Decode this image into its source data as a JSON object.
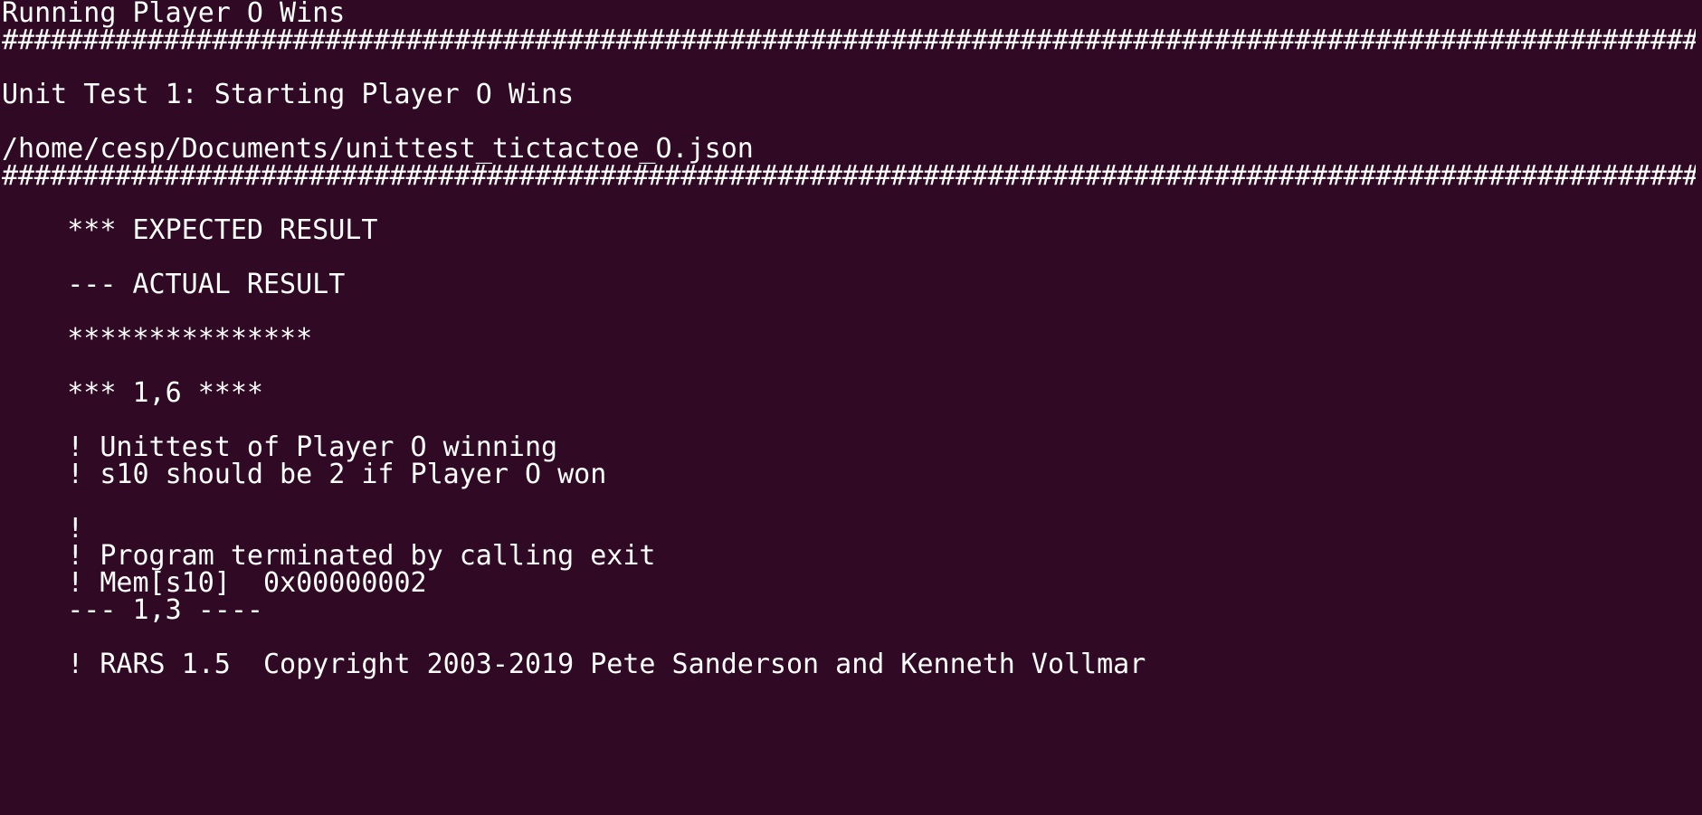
{
  "terminal": {
    "lines": [
      "Running Player O Wins",
      "##############################################################################################################################",
      "",
      "Unit Test 1: Starting Player O Wins",
      "",
      "/home/cesp/Documents/unittest_tictactoe_O.json",
      "##############################################################################################################################",
      "",
      "    *** EXPECTED RESULT",
      "",
      "    --- ACTUAL RESULT",
      "",
      "    ***************",
      "",
      "    *** 1,6 ****",
      "",
      "    ! Unittest of Player O winning",
      "    ! s10 should be 2 if Player O won",
      "",
      "    !",
      "    ! Program terminated by calling exit",
      "    ! Mem[s10]  0x00000002",
      "    --- 1,3 ----",
      "",
      "    ! RARS 1.5  Copyright 2003-2019 Pete Sanderson and Kenneth Vollmar"
    ]
  }
}
